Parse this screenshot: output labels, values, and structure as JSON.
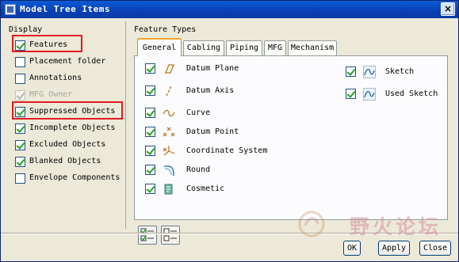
{
  "window": {
    "title": "Model Tree Items",
    "close_glyph": "×"
  },
  "display": {
    "label": "Display",
    "options": [
      {
        "label": "Features",
        "checked": true,
        "disabled": false,
        "highlighted": true
      },
      {
        "label": "Placement folder",
        "checked": false,
        "disabled": false,
        "highlighted": false
      },
      {
        "label": "Annotations",
        "checked": false,
        "disabled": false,
        "highlighted": false
      },
      {
        "label": "MFG Owner",
        "checked": true,
        "disabled": true,
        "highlighted": false
      },
      {
        "label": "Suppressed Objects",
        "checked": true,
        "disabled": false,
        "highlighted": true
      },
      {
        "label": "Incomplete Objects",
        "checked": true,
        "disabled": false,
        "highlighted": false
      },
      {
        "label": "Excluded Objects",
        "checked": true,
        "disabled": false,
        "highlighted": false
      },
      {
        "label": "Blanked Objects",
        "checked": true,
        "disabled": false,
        "highlighted": false
      },
      {
        "label": "Envelope Components",
        "checked": false,
        "disabled": false,
        "highlighted": false
      }
    ]
  },
  "feature_types": {
    "label": "Feature Types",
    "tabs": [
      "General",
      "Cabling",
      "Piping",
      "MFG",
      "Mechanism"
    ],
    "active_tab": "General",
    "left_items": [
      {
        "label": "Datum Plane",
        "checked": true,
        "icon": "datum-plane-icon"
      },
      {
        "label": "Datum Axis",
        "checked": true,
        "icon": "datum-axis-icon"
      },
      {
        "label": "Curve",
        "checked": true,
        "icon": "curve-icon"
      },
      {
        "label": "Datum Point",
        "checked": true,
        "icon": "datum-point-icon"
      },
      {
        "label": "Coordinate System",
        "checked": true,
        "icon": "coordinate-system-icon"
      },
      {
        "label": "Round",
        "checked": true,
        "icon": "round-icon"
      },
      {
        "label": "Cosmetic",
        "checked": true,
        "icon": "cosmetic-icon"
      }
    ],
    "right_items": [
      {
        "label": "Sketch",
        "checked": true,
        "icon": "sketch-icon"
      },
      {
        "label": "Used Sketch",
        "checked": true,
        "icon": "used-sketch-icon"
      }
    ],
    "select_all_icon": "select-all-icon",
    "deselect_all_icon": "deselect-all-icon"
  },
  "buttons": {
    "ok": "OK",
    "apply": "Apply",
    "close": "Close"
  },
  "watermark": {
    "text": "野火论坛"
  },
  "colors": {
    "title_bar": "#0a3fb4",
    "highlight_box": "#e31b23",
    "check": "#21a121",
    "tab_accent": "#f1a62c"
  }
}
